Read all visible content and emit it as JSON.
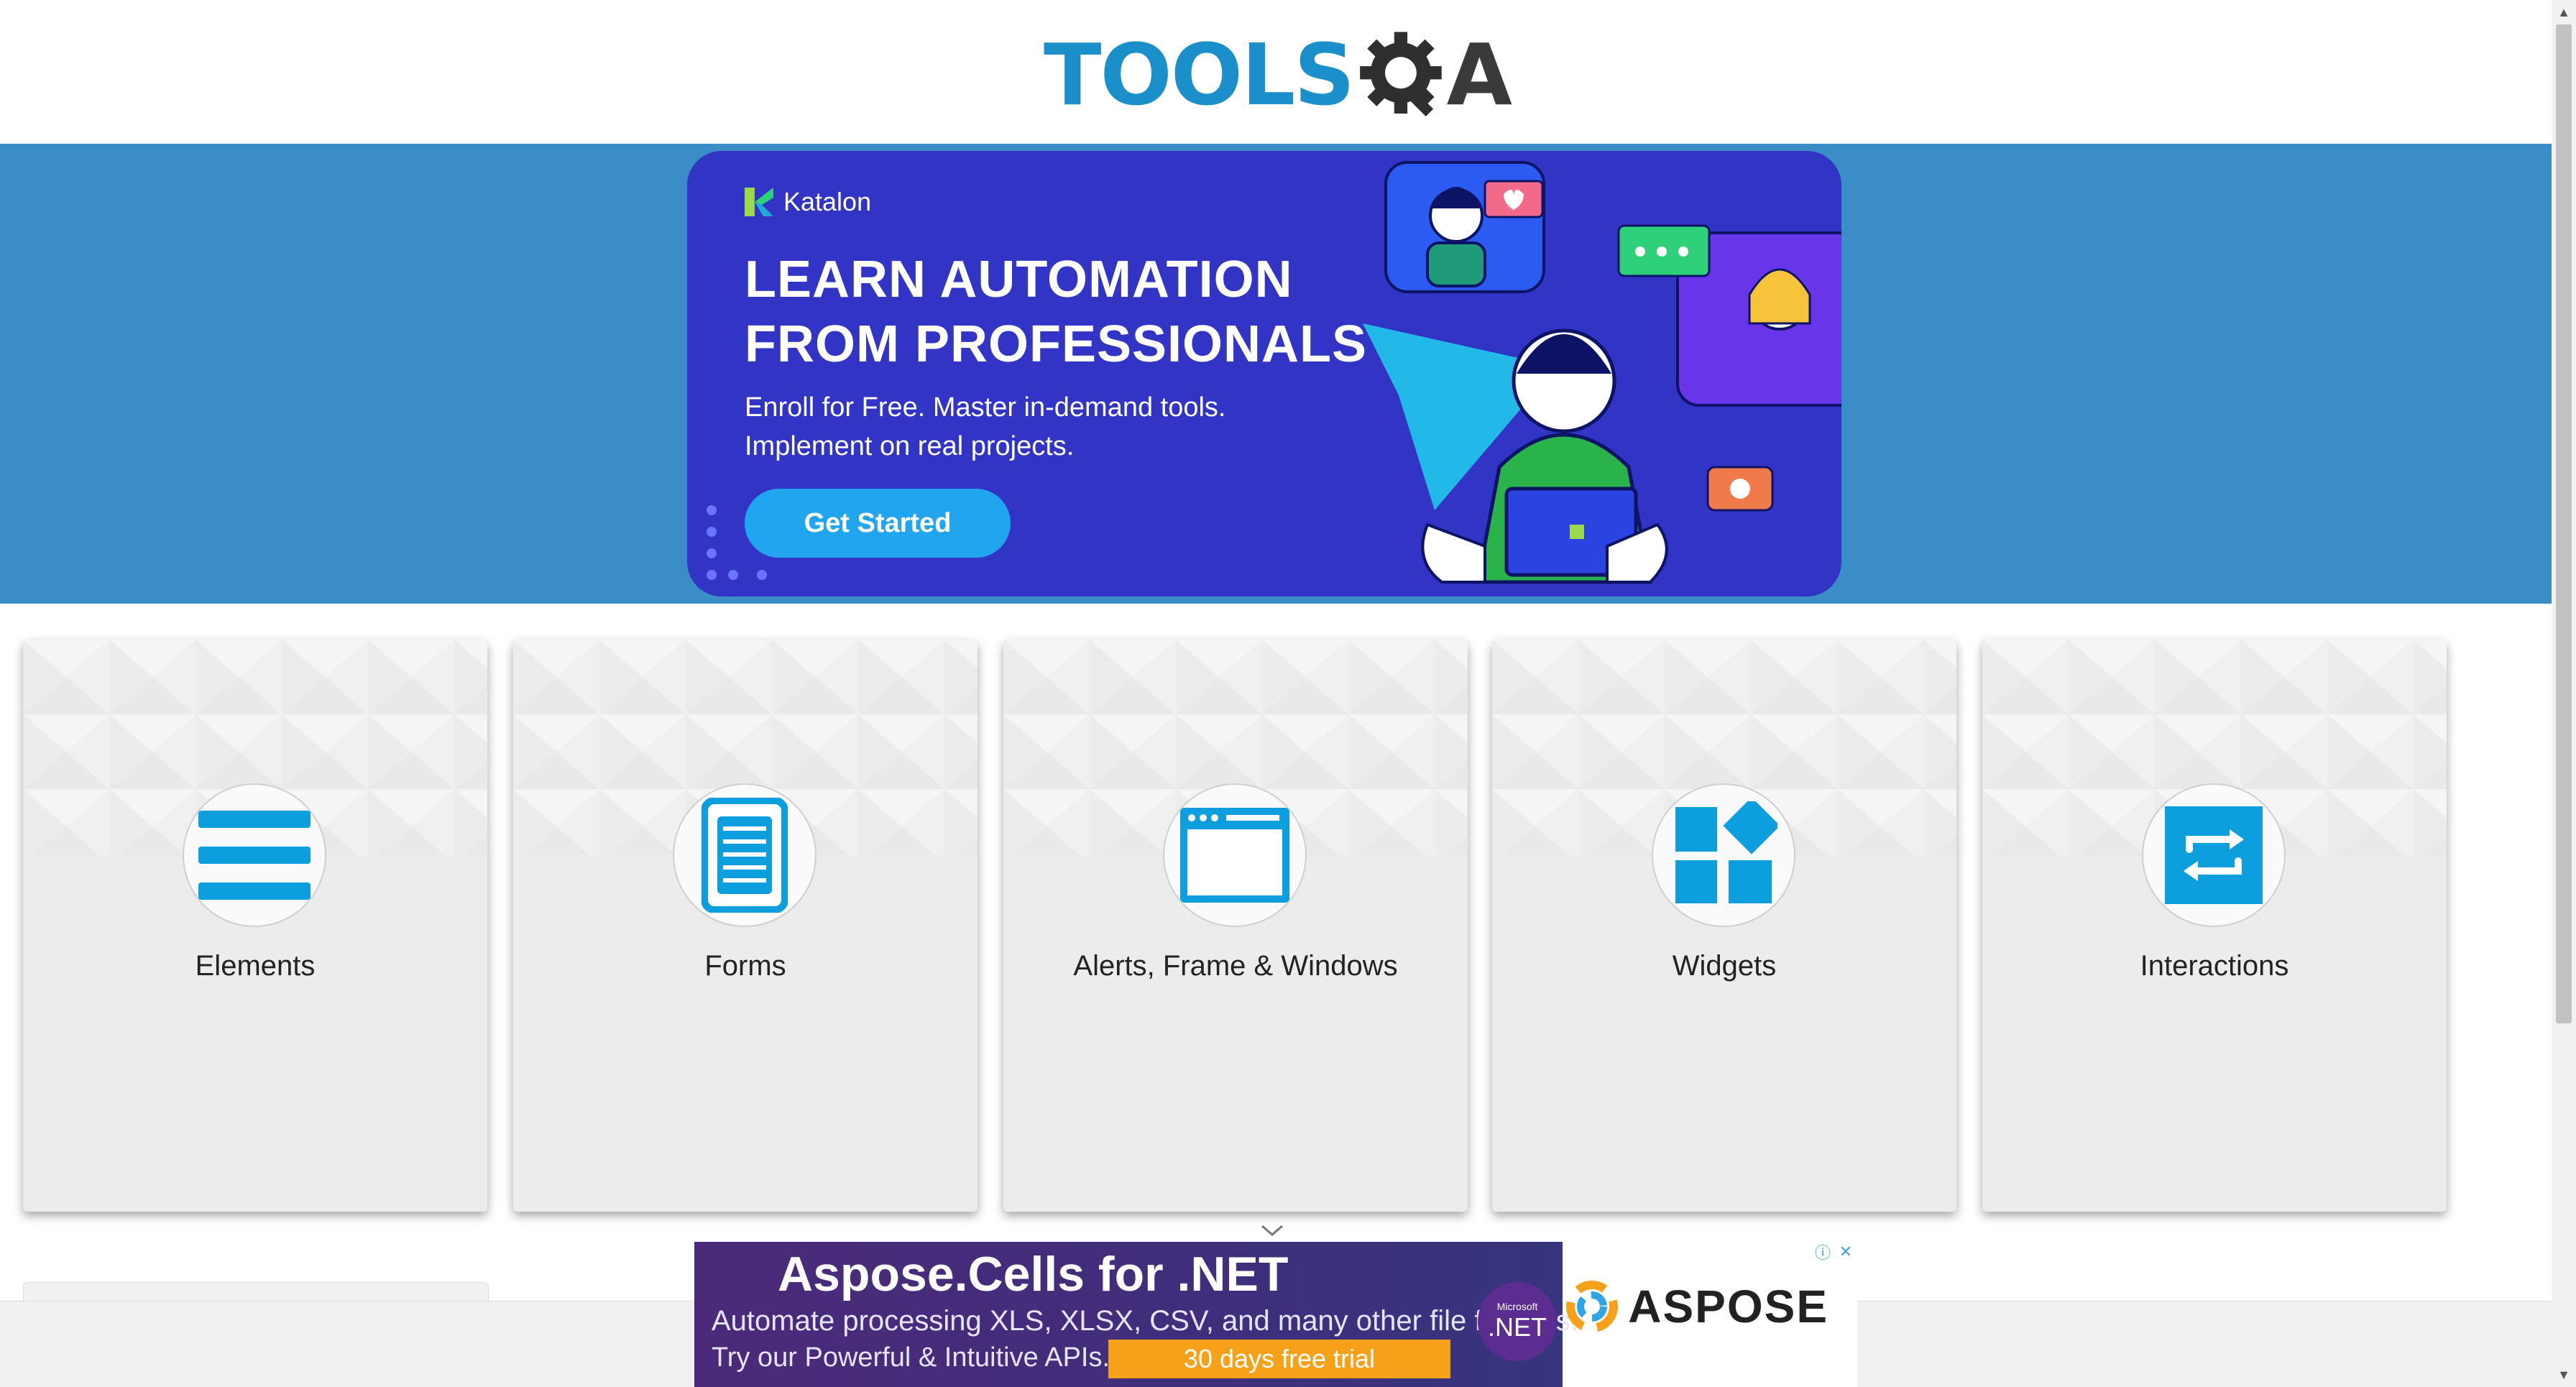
{
  "logo": {
    "tools": "TOOLS",
    "q": "Q",
    "a": "A"
  },
  "banner": {
    "brand": "Katalon",
    "headline_line1": "LEARN AUTOMATION",
    "headline_line2": "FROM PROFESSIONALS",
    "sub_line1": "Enroll for Free. Master in-demand tools.",
    "sub_line2": "Implement on real projects.",
    "cta": "Get Started",
    "bg_color": "#3234c6",
    "strip_color": "#3a8dc7"
  },
  "cards": [
    {
      "label": "Elements",
      "icon": "hamburger-list-icon"
    },
    {
      "label": "Forms",
      "icon": "document-form-icon"
    },
    {
      "label": "Alerts, Frame & Windows",
      "icon": "browser-window-icon"
    },
    {
      "label": "Widgets",
      "icon": "widgets-grid-icon"
    },
    {
      "label": "Interactions",
      "icon": "swap-arrows-icon"
    }
  ],
  "ad": {
    "title": "Aspose.Cells for .NET",
    "line1": "Automate processing XLS, XLSX, CSV, and many other file formats.",
    "line2": "Try our Powerful & Intuitive APIs.",
    "trial": "30 days free trial",
    "net_small": "Microsoft",
    "net_big": ".NET",
    "brand": "ASPOSE"
  },
  "colors": {
    "accent": "#1b8fc9",
    "icon_blue": "#0d9ede",
    "card_bg": "#ececec"
  }
}
